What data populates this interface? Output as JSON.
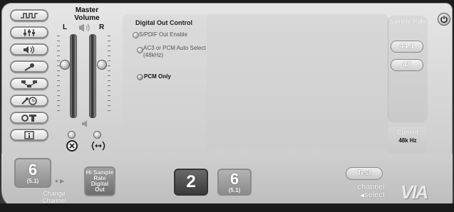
{
  "sidebar": {
    "items": [
      {
        "name": "waveform-icon",
        "active": false
      },
      {
        "name": "mixer-icon",
        "active": false
      },
      {
        "name": "speaker-icon",
        "active": false
      },
      {
        "name": "microphone-icon",
        "active": false
      },
      {
        "name": "speaker-setup-icon",
        "active": false
      },
      {
        "name": "effects-icon",
        "active": false
      },
      {
        "name": "tools-icon",
        "active": false
      },
      {
        "name": "info-icon",
        "active": false
      }
    ]
  },
  "master_volume": {
    "title": "Master Volume",
    "left_label": "L",
    "right_label": "R",
    "left_level": 0.65,
    "right_level": 0.65
  },
  "digital_out": {
    "title": "Digital Out Control",
    "options": [
      {
        "label": "S/PDIF Out Enable",
        "selected": false
      },
      {
        "label": "AC3 or PCM Auto Select (48kHz)",
        "selected": false
      },
      {
        "label": "PCM Only",
        "selected": true
      }
    ]
  },
  "sample_rate": {
    "title": "Sample Rate",
    "options": [
      "44.1",
      "48"
    ],
    "current_title": "Current",
    "current_value": "48k Hz"
  },
  "channel": {
    "current_number": "6",
    "current_sub": "(5.1)",
    "change_label": "Change Channel",
    "hi_sample_label": "Hi Sample Rate Digital Out",
    "ch2_label": "2",
    "ch6_label": "6",
    "ch6_sub": "(5.1)",
    "test_label": "Test",
    "select_label_1": "channel",
    "select_label_2": "select"
  },
  "brand": {
    "logo": "VIA"
  }
}
